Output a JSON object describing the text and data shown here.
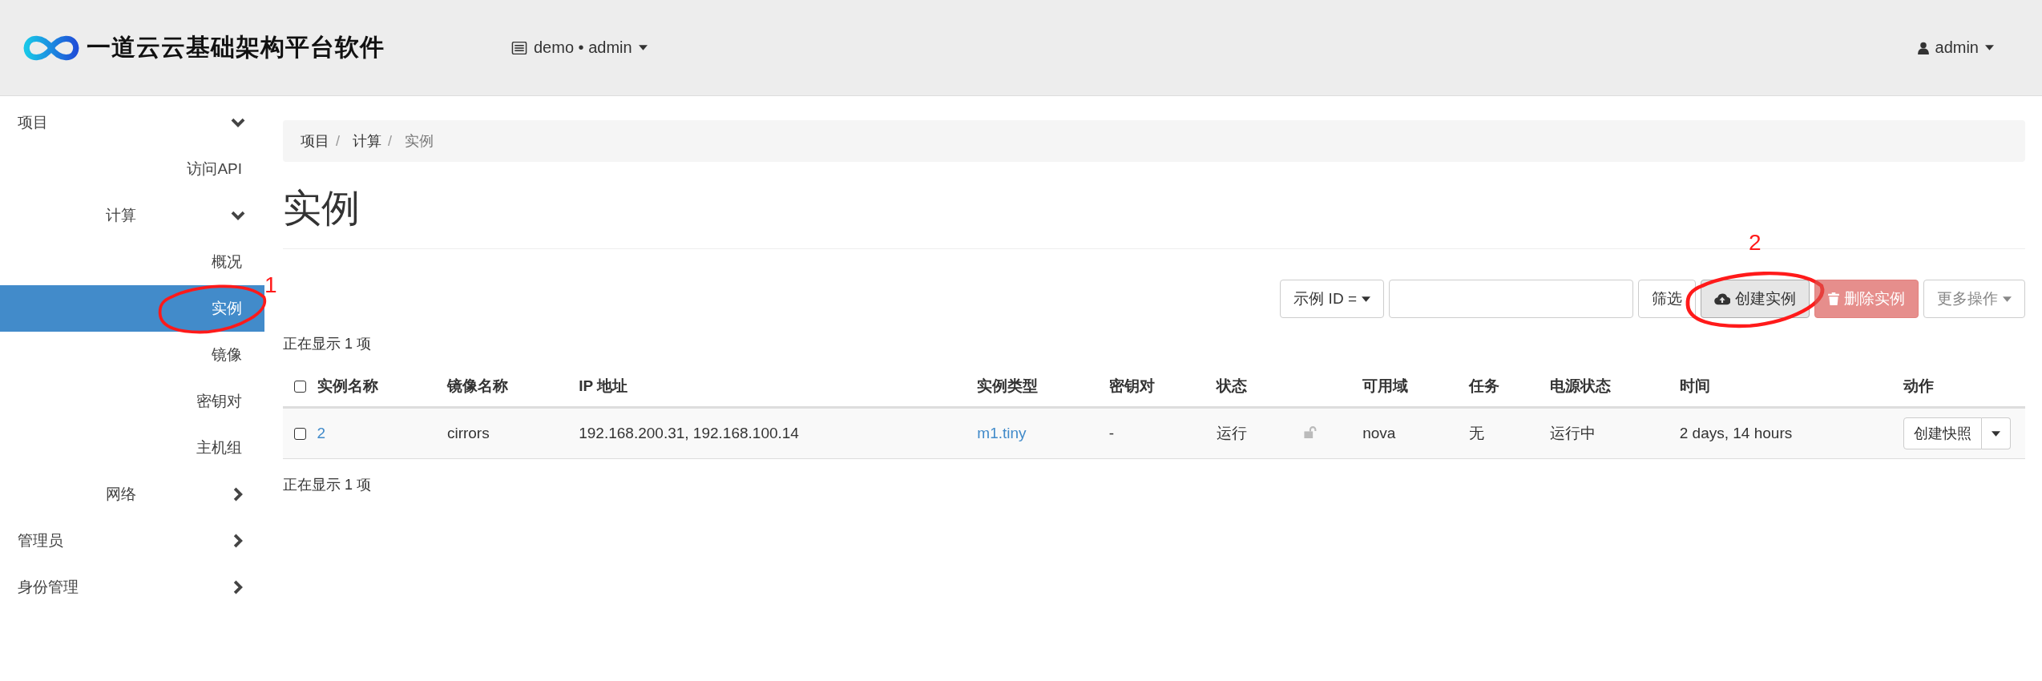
{
  "header": {
    "logo_text": "一道云云基础架构平台软件",
    "project_menu": "demo • admin",
    "user_menu": "admin"
  },
  "sidebar": {
    "items": [
      {
        "label": "项目",
        "expanded": true,
        "selected": false,
        "children": [
          {
            "label": "访问API",
            "selected": false
          },
          {
            "label": "计算",
            "expanded": true,
            "selected": false,
            "children": [
              {
                "label": "概况",
                "selected": false
              },
              {
                "label": "实例",
                "selected": true
              },
              {
                "label": "镜像",
                "selected": false
              },
              {
                "label": "密钥对",
                "selected": false
              },
              {
                "label": "主机组",
                "selected": false
              }
            ]
          },
          {
            "label": "网络",
            "expanded": false,
            "selected": false
          }
        ]
      },
      {
        "label": "管理员",
        "expanded": false,
        "selected": false
      },
      {
        "label": "身份管理",
        "expanded": false,
        "selected": false
      }
    ]
  },
  "breadcrumb": [
    "项目",
    "计算",
    "实例"
  ],
  "breadcrumb_separator": "/",
  "page_title": "实例",
  "toolbar": {
    "filter_field": "示例 ID =",
    "filter_button": "筛选",
    "create_button": "创建实例",
    "delete_button": {
      "label": "删除实例",
      "disabled": true
    },
    "more_button": {
      "label": "更多操作",
      "disabled": true
    }
  },
  "count_top": "正在显示 1 项",
  "table": {
    "select_all_checked": false,
    "columns": [
      "实例名称",
      "镜像名称",
      "IP 地址",
      "实例类型",
      "密钥对",
      "状态",
      "可用域",
      "任务",
      "电源状态",
      "时间",
      "动作"
    ],
    "rows": [
      {
        "checked": false,
        "name": "2",
        "image": "cirrors",
        "ip": "192.168.200.31, 192.168.100.14",
        "flavor": "m1.tiny",
        "keypair": "-",
        "status": "运行",
        "locked": false,
        "zone": "nova",
        "task": "无",
        "power": "运行中",
        "age": "2 days, 14 hours",
        "action": "创建快照"
      }
    ]
  },
  "count_bottom": "正在显示 1 项",
  "annotations": [
    {
      "label": "1"
    },
    {
      "label": "2"
    }
  ]
}
